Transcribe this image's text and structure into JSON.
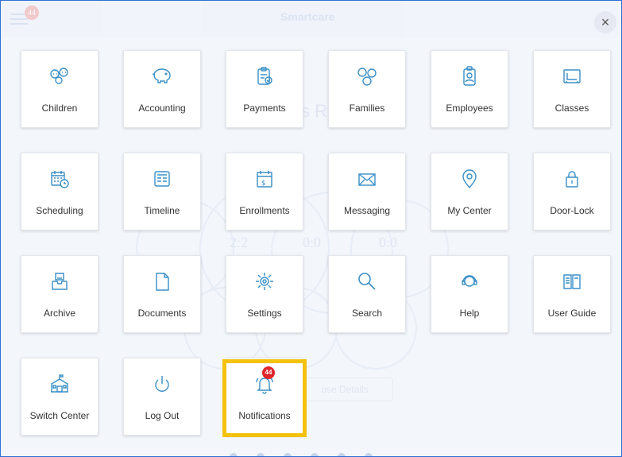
{
  "app": {
    "brand": "Smartcare",
    "menu_badge": "44"
  },
  "background": {
    "heading_fragment": "s R",
    "counters": [
      "2:2",
      "0:0",
      "0:0"
    ],
    "button_fragment": "ose Details"
  },
  "close_label": "×",
  "tiles": [
    {
      "label": "Children",
      "icon": "children-icon"
    },
    {
      "label": "Accounting",
      "icon": "piggy-bank-icon"
    },
    {
      "label": "Payments",
      "icon": "clipboard-check-icon"
    },
    {
      "label": "Families",
      "icon": "family-icon"
    },
    {
      "label": "Employees",
      "icon": "employee-badge-icon"
    },
    {
      "label": "Classes",
      "icon": "classroom-board-icon"
    },
    {
      "label": "Scheduling",
      "icon": "calendar-clock-icon"
    },
    {
      "label": "Timeline",
      "icon": "timeline-icon"
    },
    {
      "label": "Enrollments",
      "icon": "calendar-dollar-icon"
    },
    {
      "label": "Messaging",
      "icon": "envelope-icon"
    },
    {
      "label": "My Center",
      "icon": "location-pin-icon"
    },
    {
      "label": "Door-Lock",
      "icon": "padlock-icon"
    },
    {
      "label": "Archive",
      "icon": "archive-box-icon"
    },
    {
      "label": "Documents",
      "icon": "document-icon"
    },
    {
      "label": "Settings",
      "icon": "gear-icon"
    },
    {
      "label": "Search",
      "icon": "magnifier-icon"
    },
    {
      "label": "Help",
      "icon": "help-headset-icon"
    },
    {
      "label": "User Guide",
      "icon": "book-icon"
    },
    {
      "label": "Switch Center",
      "icon": "school-building-icon"
    },
    {
      "label": "Log Out",
      "icon": "power-icon"
    },
    {
      "label": "Notifications",
      "icon": "bell-icon",
      "badge": "44"
    }
  ],
  "colors": {
    "icon": "#3a8fc7",
    "highlight": "#f4c10f",
    "badge": "#e0242b"
  }
}
